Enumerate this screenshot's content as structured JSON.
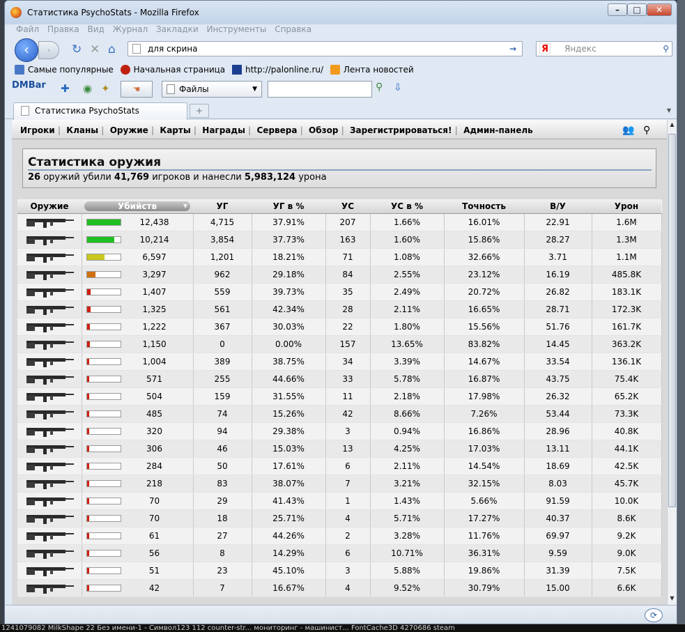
{
  "window": {
    "title": "Статистика PsychoStats - Mozilla Firefox"
  },
  "menu": [
    "Файл",
    "Правка",
    "Вид",
    "Журнал",
    "Закладки",
    "Инструменты",
    "Справка"
  ],
  "address": {
    "value": "для скрина"
  },
  "search": {
    "placeholder": "Яндекс",
    "engine_glyph": "Я"
  },
  "bookmarks": [
    "Самые популярные",
    "Начальная страница",
    "http://palonline.ru/",
    "Лента новостей"
  ],
  "dmbar": {
    "logo": "DMBar",
    "files_label": "Файлы"
  },
  "tab": {
    "title": "Статистика PsychoStats"
  },
  "site_nav": [
    "Игроки",
    "Кланы",
    "Оружие",
    "Карты",
    "Награды",
    "Сервера",
    "Обзор",
    "Зарегистрироваться!",
    "Админ-панель"
  ],
  "stats": {
    "title": "Статистика оружия",
    "weapons": "26",
    "t1": " оружий убили ",
    "players": "41,769",
    "t2": " игроков и нанесли ",
    "damage": "5,983,124",
    "t3": " урона"
  },
  "table": {
    "headers": [
      "Оружие",
      "Убийств",
      "УГ",
      "УГ в %",
      "УС",
      "УС в %",
      "Точность",
      "В/У",
      "Урон"
    ],
    "rows": [
      [
        "12,438",
        "4,715",
        "37.91%",
        "207",
        "1.66%",
        "16.01%",
        "22.91",
        "1.6M"
      ],
      [
        "10,214",
        "3,854",
        "37.73%",
        "163",
        "1.60%",
        "15.86%",
        "28.27",
        "1.3M"
      ],
      [
        "6,597",
        "1,201",
        "18.21%",
        "71",
        "1.08%",
        "32.66%",
        "3.71",
        "1.1M"
      ],
      [
        "3,297",
        "962",
        "29.18%",
        "84",
        "2.55%",
        "23.12%",
        "16.19",
        "485.8K"
      ],
      [
        "1,407",
        "559",
        "39.73%",
        "35",
        "2.49%",
        "20.72%",
        "26.82",
        "183.1K"
      ],
      [
        "1,325",
        "561",
        "42.34%",
        "28",
        "2.11%",
        "16.65%",
        "28.71",
        "172.3K"
      ],
      [
        "1,222",
        "367",
        "30.03%",
        "22",
        "1.80%",
        "15.56%",
        "51.76",
        "161.7K"
      ],
      [
        "1,150",
        "0",
        "0.00%",
        "157",
        "13.65%",
        "83.82%",
        "14.45",
        "363.2K"
      ],
      [
        "1,004",
        "389",
        "38.75%",
        "34",
        "3.39%",
        "14.67%",
        "33.54",
        "136.1K"
      ],
      [
        "571",
        "255",
        "44.66%",
        "33",
        "5.78%",
        "16.87%",
        "43.75",
        "75.4K"
      ],
      [
        "504",
        "159",
        "31.55%",
        "11",
        "2.18%",
        "17.98%",
        "26.32",
        "65.2K"
      ],
      [
        "485",
        "74",
        "15.26%",
        "42",
        "8.66%",
        "7.26%",
        "53.44",
        "73.3K"
      ],
      [
        "320",
        "94",
        "29.38%",
        "3",
        "0.94%",
        "16.86%",
        "28.96",
        "40.8K"
      ],
      [
        "306",
        "46",
        "15.03%",
        "13",
        "4.25%",
        "17.03%",
        "13.11",
        "44.1K"
      ],
      [
        "284",
        "50",
        "17.61%",
        "6",
        "2.11%",
        "14.54%",
        "18.69",
        "42.5K"
      ],
      [
        "218",
        "83",
        "38.07%",
        "7",
        "3.21%",
        "32.15%",
        "8.03",
        "45.7K"
      ],
      [
        "70",
        "29",
        "41.43%",
        "1",
        "1.43%",
        "5.66%",
        "91.59",
        "10.0K"
      ],
      [
        "70",
        "18",
        "25.71%",
        "4",
        "5.71%",
        "17.27%",
        "40.37",
        "8.6K"
      ],
      [
        "61",
        "27",
        "44.26%",
        "2",
        "3.28%",
        "11.76%",
        "69.97",
        "9.2K"
      ],
      [
        "56",
        "8",
        "14.29%",
        "6",
        "10.71%",
        "36.31%",
        "9.59",
        "9.0K"
      ],
      [
        "51",
        "23",
        "45.10%",
        "3",
        "5.88%",
        "19.86%",
        "31.39",
        "7.5K"
      ],
      [
        "42",
        "7",
        "16.67%",
        "4",
        "9.52%",
        "30.79%",
        "15.00",
        "6.6K"
      ]
    ],
    "kill_bars": [
      {
        "pct": 100,
        "color": "#20c020"
      },
      {
        "pct": 82,
        "color": "#20c020"
      },
      {
        "pct": 53,
        "color": "#c8c820"
      },
      {
        "pct": 27,
        "color": "#d07010"
      },
      {
        "pct": 11,
        "color": "#d02010"
      },
      {
        "pct": 11,
        "color": "#d02010"
      },
      {
        "pct": 10,
        "color": "#d02010"
      },
      {
        "pct": 9,
        "color": "#d02010"
      },
      {
        "pct": 8,
        "color": "#d02010"
      },
      {
        "pct": 5,
        "color": "#d02010"
      },
      {
        "pct": 4,
        "color": "#d02010"
      },
      {
        "pct": 4,
        "color": "#d02010"
      },
      {
        "pct": 3,
        "color": "#d02010"
      },
      {
        "pct": 2,
        "color": "#d02010"
      },
      {
        "pct": 2,
        "color": "#d02010"
      },
      {
        "pct": 2,
        "color": "#d02010"
      },
      {
        "pct": 1,
        "color": "#d02010"
      },
      {
        "pct": 1,
        "color": "#d02010"
      },
      {
        "pct": 1,
        "color": "#d02010"
      },
      {
        "pct": 1,
        "color": "#d02010"
      },
      {
        "pct": 1,
        "color": "#d02010"
      },
      {
        "pct": 1,
        "color": "#d02010"
      }
    ]
  },
  "taskbar": "1241079082     MilkShape      22       Без имени-1 - Символ123      112       counter-str...   мониторинг - машинист...   FontCache3D    4270686    steam"
}
